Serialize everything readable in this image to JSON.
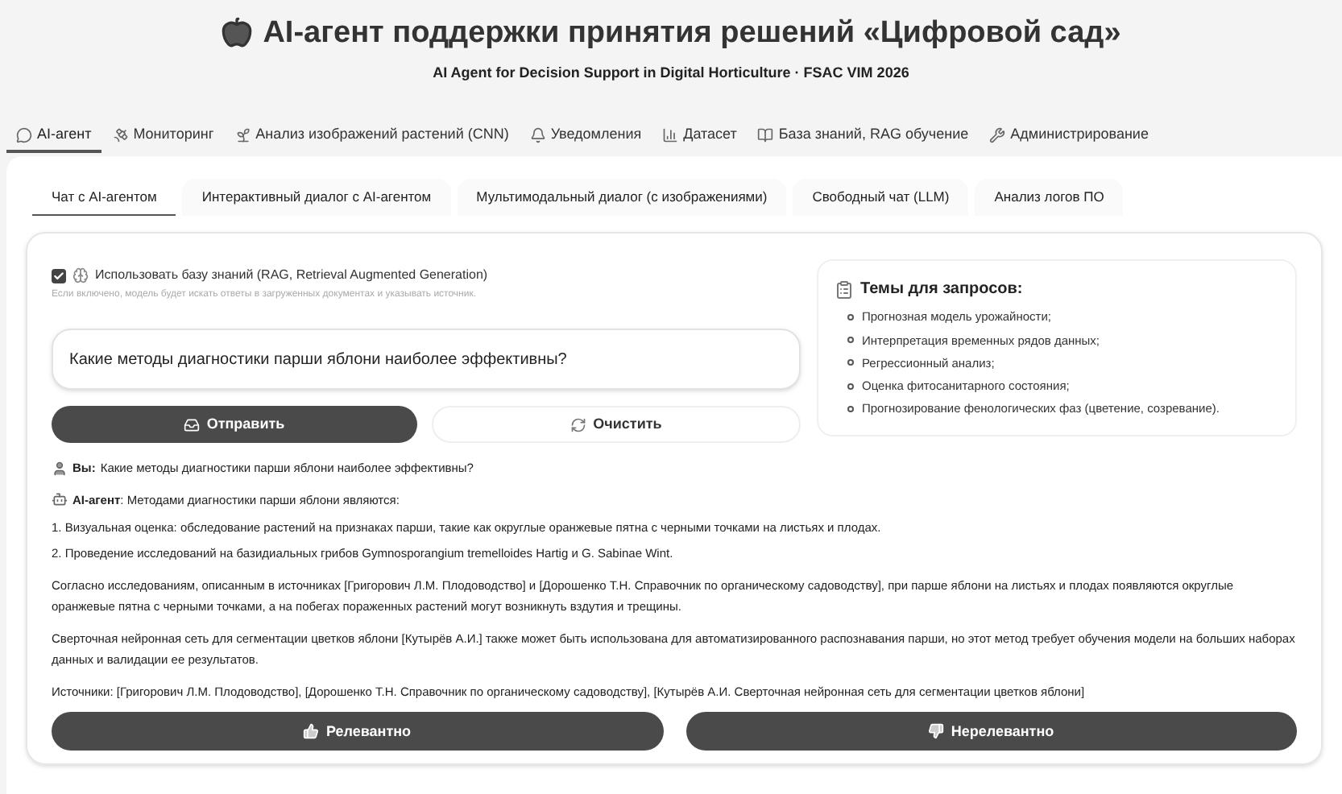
{
  "header": {
    "title": "AI-агент поддержки принятия решений «Цифровой сад»",
    "subtitle": "AI Agent for Decision Support in Digital Horticulture · FSAC VIM 2026"
  },
  "main_tabs": [
    {
      "label": "AI-агент",
      "selected": true
    },
    {
      "label": "Мониторинг",
      "selected": false
    },
    {
      "label": "Анализ изображений растений (CNN)",
      "selected": false
    },
    {
      "label": "Уведомления",
      "selected": false
    },
    {
      "label": "Датасет",
      "selected": false
    },
    {
      "label": "База знаний, RAG обучение",
      "selected": false
    },
    {
      "label": "Администрирование",
      "selected": false
    }
  ],
  "sub_tabs": [
    {
      "label": "Чат с AI-агентом",
      "selected": true
    },
    {
      "label": "Интерактивный диалог с AI-агентом",
      "selected": false
    },
    {
      "label": "Мультимодальный диалог (с изображениями)",
      "selected": false
    },
    {
      "label": "Свободный чат (LLM)",
      "selected": false
    },
    {
      "label": "Анализ логов ПО",
      "selected": false
    }
  ],
  "rag": {
    "label": "Использовать базу знаний (RAG, Retrieval Augmented Generation)",
    "checked": true,
    "hint": "Если включено, модель будет искать ответы в загруженных документах и указывать источник."
  },
  "question_field": {
    "value": "Какие методы диагностики парши яблони наиболее эффективны?"
  },
  "buttons": [
    {
      "kind": "primary",
      "label": "Отправить"
    },
    {
      "kind": "secondary",
      "label": "Очистить"
    }
  ],
  "topics": {
    "title": "Темы для запросов:",
    "items": [
      "Прогнозная модель урожайности;",
      "Интерпретация временных рядов данных;",
      "Регрессионный анализ;",
      "Оценка фитосанитарного состояния;",
      "Прогнозирование фенологических фаз (цветение, созревание)."
    ]
  },
  "user_message": {
    "speaker": "Вы:",
    "text": "Какие методы диагностики парши яблони наиболее эффективны?"
  },
  "agent_message": {
    "speaker": "AI-агент",
    "text": ": Методами диагностики парши яблони являются:",
    "list": [
      "1. Визуальная оценка: обследование растений на признаках парши, такие как округлые оранжевые пятна с черными точками на листьях и плодах.",
      "2. Проведение исследований на базидиальных грибов Gymnosporangium tremelloides Hartig и G. Sabinae Wint."
    ],
    "paragraphs": [
      "Согласно исследованиям, описанным в источниках [Григорович Л.М. Плодоводство] и [Дорошенко Т.Н. Справочник по органическому садоводству], при парше яблони на листьях и плодах появляются округлые оранжевые пятна с черными точками, а на побегах пораженных растений могут возникнуть вздутия и трещины.",
      "Сверточная нейронная сеть для сегментации цветков яблони [Кутырёв А.И.] также может быть использована для автоматизированного распознавания парши, но этот метод требует обучения модели на больших наборах данных и валидации ее результатов.",
      "Источники: [Григорович Л.М. Плодоводство], [Дорошенко Т.Н. Справочник по органическому садоводству], [Кутырёв А.И. Сверточная нейронная сеть для сегментации цветков яблони]"
    ]
  },
  "feedback_buttons": [
    {
      "kind": "up",
      "label": "Релевантно"
    },
    {
      "kind": "down",
      "label": "Нерелевантно"
    }
  ]
}
